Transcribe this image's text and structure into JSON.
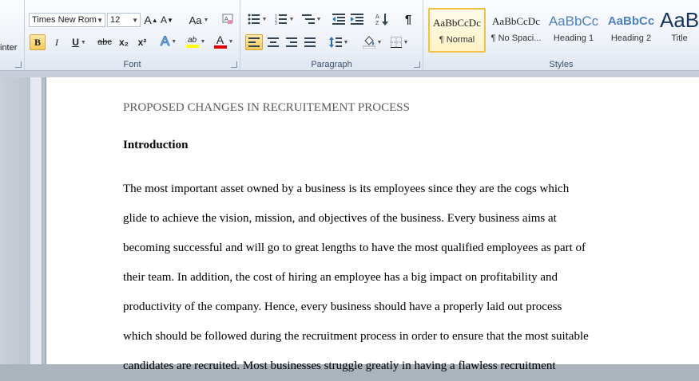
{
  "ribbon": {
    "clipboard": {
      "painter_label": "inter"
    },
    "font": {
      "group_label": "Font",
      "font_name": "Times New Rom",
      "font_size": "12",
      "grow": "A",
      "shrink": "A",
      "change_case": "Aa",
      "bold": "B",
      "italic": "I",
      "underline": "U",
      "strike": "abc",
      "subscript": "x₂",
      "superscript": "x²",
      "effects": "A",
      "highlight": "ab",
      "font_color": "A"
    },
    "paragraph": {
      "group_label": "Paragraph",
      "show_marks": "¶"
    },
    "styles": {
      "group_label": "Styles",
      "items": [
        {
          "preview": "AaBbCcDc",
          "name": "¶ Normal"
        },
        {
          "preview": "AaBbCcDc",
          "name": "¶ No Spaci..."
        },
        {
          "preview": "AaBbCc",
          "name": "Heading 1"
        },
        {
          "preview": "AaBbCc",
          "name": "Heading 2"
        },
        {
          "preview": "AaB",
          "name": "Title"
        }
      ]
    },
    "colors": {
      "accent": "#f0c14b",
      "heading": "#4f81bd",
      "font_color_bar": "#e00000",
      "highlight_bar": "#ffff00"
    }
  },
  "document": {
    "title": "PROPOSED CHANGES IN RECRUITEMENT PROCESS",
    "heading": "Introduction",
    "lines": [
      "The most important asset owned by a business is its employees since they are the cogs which",
      "glide to achieve the vision, mission, and objectives of the business. Every business aims at",
      "becoming successful and will go to great lengths to have the most qualified employees as part of",
      "their team. In addition, the cost of hiring an employee has a big impact on profitability and",
      "productivity of the company. Hence, every business should have a properly laid out process",
      "which should be followed during the recruitment process in order to ensure that the most suitable",
      "candidates are recruited. Most businesses struggle greatly in having a flawless recruitment"
    ]
  }
}
